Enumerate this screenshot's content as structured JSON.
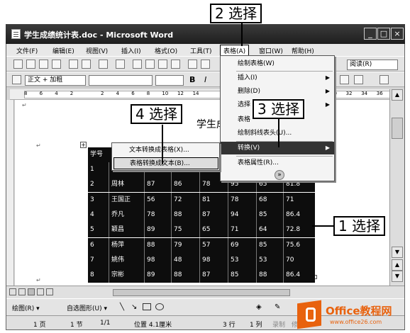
{
  "window": {
    "title": "学生成绩统计表.doc - Microsoft Word",
    "min": "_",
    "max": "□",
    "close": "×"
  },
  "menubar": {
    "items": [
      "文件(F)",
      "编辑(E)",
      "视图(V)",
      "插入(I)",
      "格式(O)",
      "工具(T)",
      "表格(A)",
      "窗口(W)",
      "帮助(H)"
    ]
  },
  "toolbar": {
    "style_value": "正文 + 加粗",
    "read_label": "阅读(R)",
    "bold": "B",
    "italic": "I"
  },
  "ruler": {
    "numbers": [
      "8",
      "6",
      "4",
      "2",
      "",
      "2",
      "4",
      "6",
      "8",
      "10",
      "12",
      "14",
      "",
      "",
      "",
      "",
      "",
      "",
      "",
      "",
      "30",
      "32",
      "34",
      "36"
    ]
  },
  "document": {
    "title_fragment": "学生成绩统",
    "header_cell": "学号",
    "rows": [
      [
        "1",
        "",
        "",
        "",
        "",
        "",
        ""
      ],
      [
        "2",
        "周林",
        "87",
        "86",
        "78",
        "95",
        "65",
        "81.8"
      ],
      [
        "3",
        "王国正",
        "56",
        "72",
        "81",
        "78",
        "68",
        "71"
      ],
      [
        "4",
        "乔凡",
        "78",
        "88",
        "87",
        "94",
        "85",
        "86.4"
      ],
      [
        "5",
        "颖昌",
        "89",
        "75",
        "65",
        "71",
        "64",
        "72.8"
      ],
      [
        "6",
        "杨萍",
        "88",
        "79",
        "57",
        "69",
        "85",
        "75.6"
      ],
      [
        "7",
        "姚伟",
        "98",
        "48",
        "98",
        "53",
        "53",
        "70"
      ],
      [
        "8",
        "宗彬",
        "89",
        "88",
        "87",
        "85",
        "88",
        "86.4"
      ]
    ]
  },
  "table_menu": {
    "items": [
      {
        "label": "绘制表格(W)",
        "arrow": ""
      },
      {
        "label": "插入(I)",
        "arrow": "▶"
      },
      {
        "label": "删除(D)",
        "arrow": "▶"
      },
      {
        "label": "选择",
        "arrow": "▶"
      },
      {
        "label": "表格",
        "arrow": ""
      },
      {
        "label": "绘制斜线表头(U)...",
        "arrow": ""
      },
      {
        "label": "转换(V)",
        "arrow": "▶"
      },
      {
        "label": "表格属性(R)...",
        "arrow": ""
      }
    ],
    "expand": "»"
  },
  "convert_submenu": {
    "items": [
      "文本转换成表格(X)...",
      "表格转换成文本(B)..."
    ]
  },
  "callouts": {
    "c1": "1 选择",
    "c2": "2 选择",
    "c3": "3 选择",
    "c4": "4 选择"
  },
  "drawbar": {
    "draw_label": "绘图(R) ▾",
    "autoshape_label": "自选图形(U) ▾"
  },
  "statusbar": {
    "page": "1 页",
    "section": "1 节",
    "pages": "1/1",
    "position": "位置 4.1厘米",
    "line": "3 行",
    "column": "1 列",
    "rec": "录制",
    "mod": "修订"
  },
  "watermark": {
    "brand": "Office教程网",
    "url": "www.office26.com"
  },
  "colors": {
    "accent": "#e8620e",
    "titlebar": "#2a2a2a",
    "table_bg": "#0d0d0d"
  }
}
